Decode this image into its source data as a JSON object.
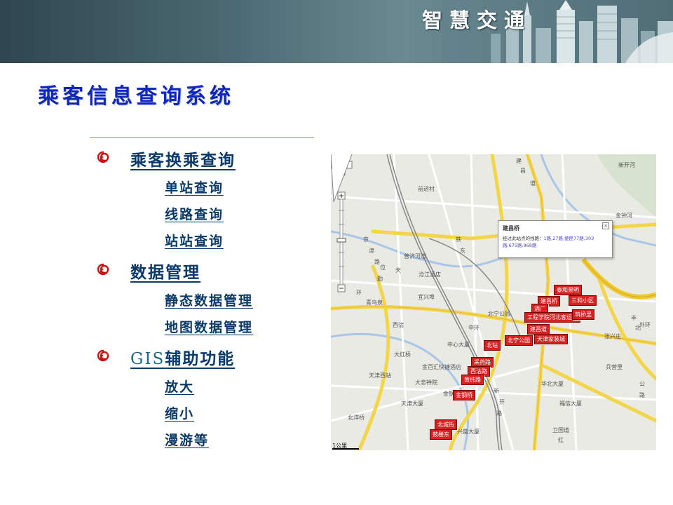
{
  "header": {
    "title": "智慧交通"
  },
  "page": {
    "title": "乘客信息查询系统"
  },
  "menu": {
    "transfer": {
      "label": "乘客换乘查询",
      "items": [
        "单站查询",
        "线路查询",
        "站站查询"
      ]
    },
    "data": {
      "label": "数据管理",
      "items": [
        "静态数据管理",
        "地图数据管理"
      ]
    },
    "gis": {
      "label_latin": "GIS",
      "label_rest": "辅助功能",
      "items": [
        "放大",
        "缩小",
        "漫游等"
      ]
    }
  },
  "map": {
    "popup": {
      "title": "建昌桥",
      "text": "经过此站点的线路：",
      "routes": "1路,27路,便民77路,303路,675路,868路"
    },
    "scale": "1公里",
    "markers": [
      "建昌桥",
      "泰和景明",
      "三和小区",
      "酒厂",
      "工程学院河北客运站",
      "筑桥里",
      "建昌道",
      "北宁公园",
      "北站",
      "天津家装城",
      "采药路",
      "西沽路",
      "黄纬路",
      "金钢桥",
      "北城街",
      "鼓楼东"
    ],
    "labels": [
      "建",
      "昌",
      "道",
      "新开河",
      "金钟河",
      "前进村",
      "京",
      "津",
      "路",
      "普济河道",
      "铁",
      "东",
      "天",
      "勤",
      "位",
      "环",
      "中环",
      "沧江酒店",
      "青鸟泉",
      "宜兴埠",
      "大红桥",
      "西沽",
      "北宁公园",
      "中心大厦",
      "金百汇快捷酒店",
      "天津西站",
      "北洋桥",
      "大悲禅院",
      "金钢桥",
      "天津大厦",
      "新",
      "开",
      "路",
      "华北大厦",
      "福信大厦",
      "兴盛大厦",
      "卫国道",
      "红",
      "张兴庄",
      "丰",
      "北",
      "公",
      "路",
      "外环",
      "兵营里"
    ]
  }
}
